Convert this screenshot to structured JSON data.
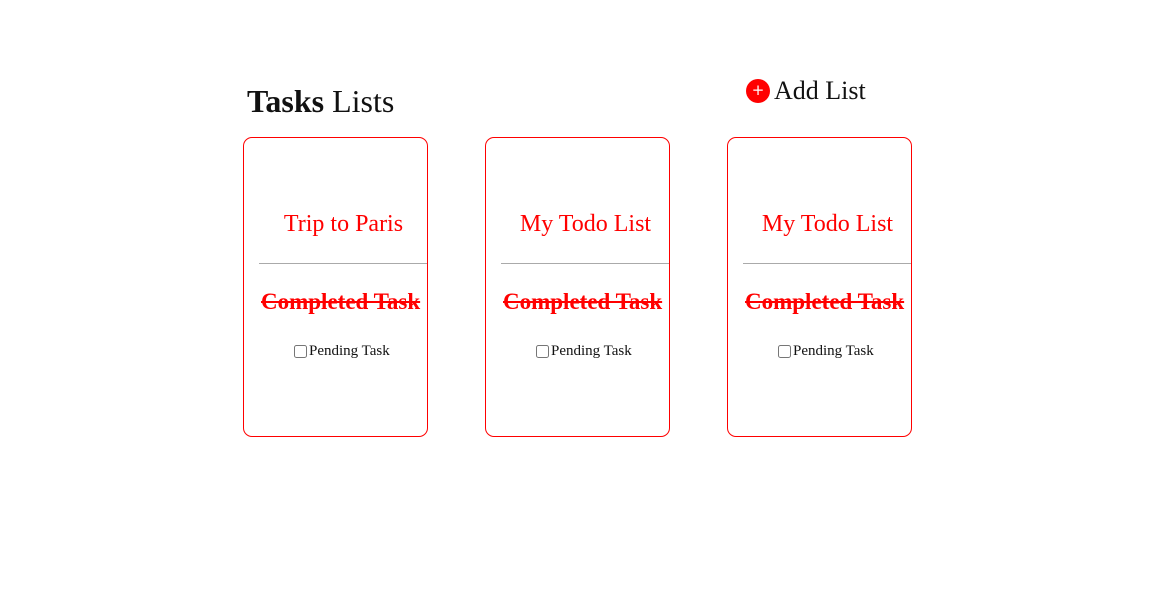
{
  "header": {
    "title_strong": "Tasks",
    "title_rest": "Lists",
    "add_list_icon": "+",
    "add_list_label": "Add List"
  },
  "colors": {
    "accent": "#ff0000",
    "divider": "#aaaaaa"
  },
  "lists": [
    {
      "title": "Trip to Paris",
      "completed_task": "Completed Task",
      "pending_task": "Pending Task",
      "pending_checked": false
    },
    {
      "title": "My Todo List",
      "completed_task": "Completed Task",
      "pending_task": "Pending Task",
      "pending_checked": false
    },
    {
      "title": "My Todo List",
      "completed_task": "Completed Task",
      "pending_task": "Pending Task",
      "pending_checked": false
    }
  ]
}
